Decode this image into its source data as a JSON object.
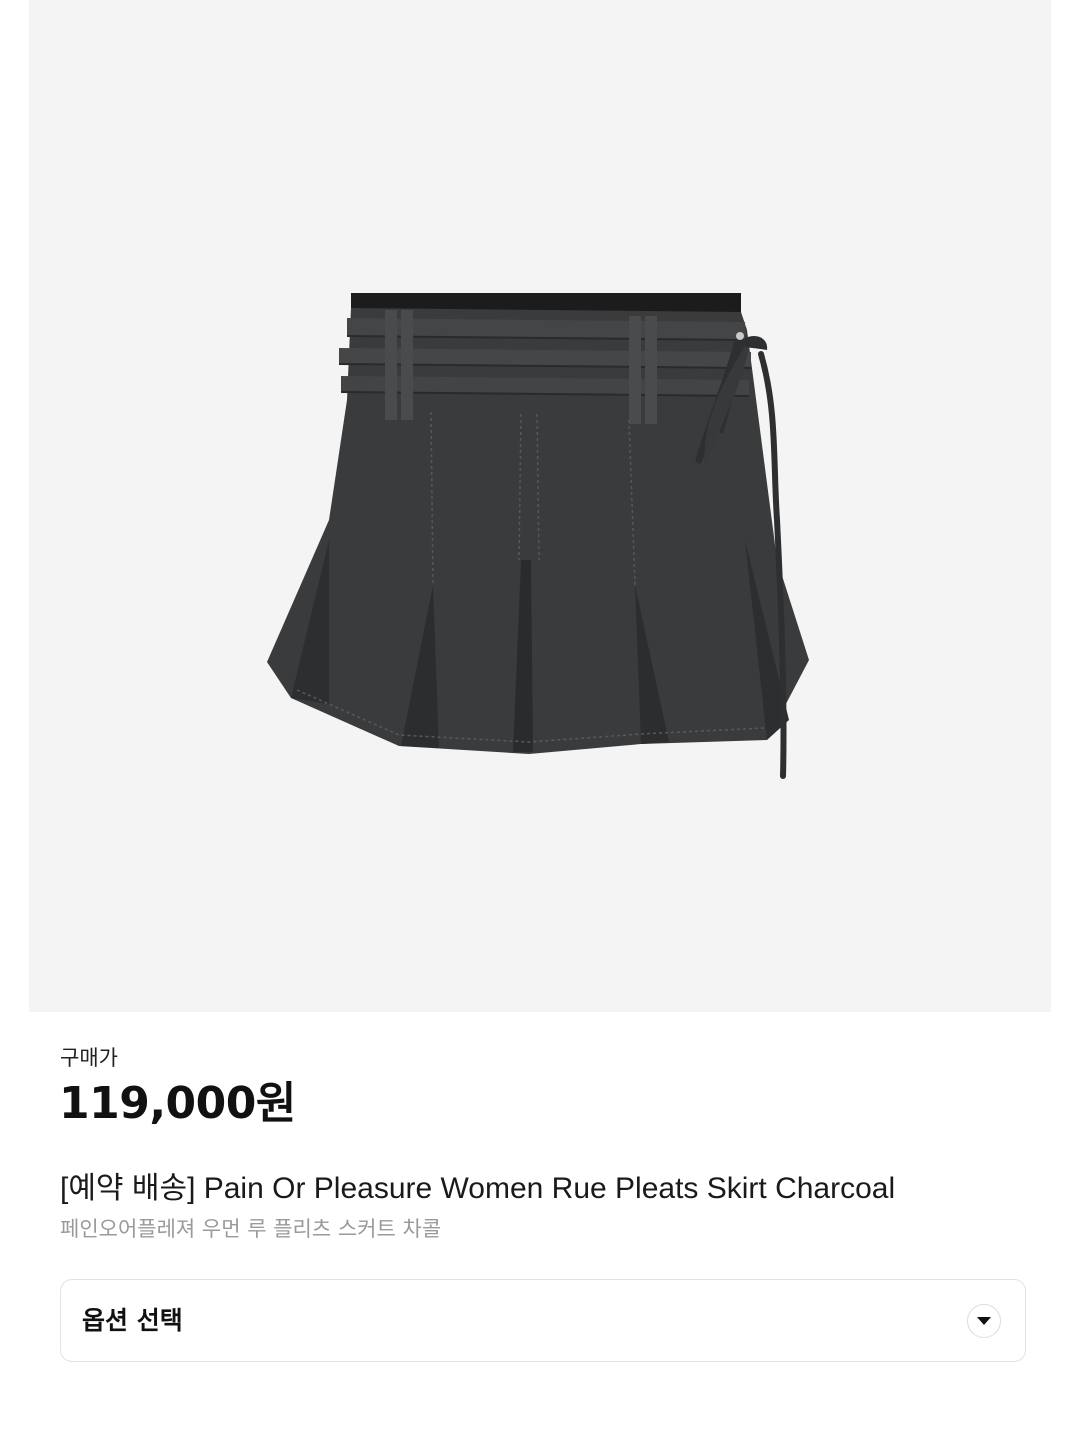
{
  "product": {
    "image_alt": "Pain Or Pleasure Women Rue Pleats Skirt Charcoal",
    "image_background": "#f4f4f4",
    "garment_color": "#3a3b3d",
    "price_label": "구매가",
    "price": "119,000원",
    "title": "[예약 배송] Pain Or Pleasure Women Rue Pleats Skirt Charcoal",
    "subtitle": "페인오어플레져 우먼 루 플리츠 스커트 차콜"
  },
  "option": {
    "label": "옵션 선택",
    "icon": "chevron-down-icon"
  }
}
